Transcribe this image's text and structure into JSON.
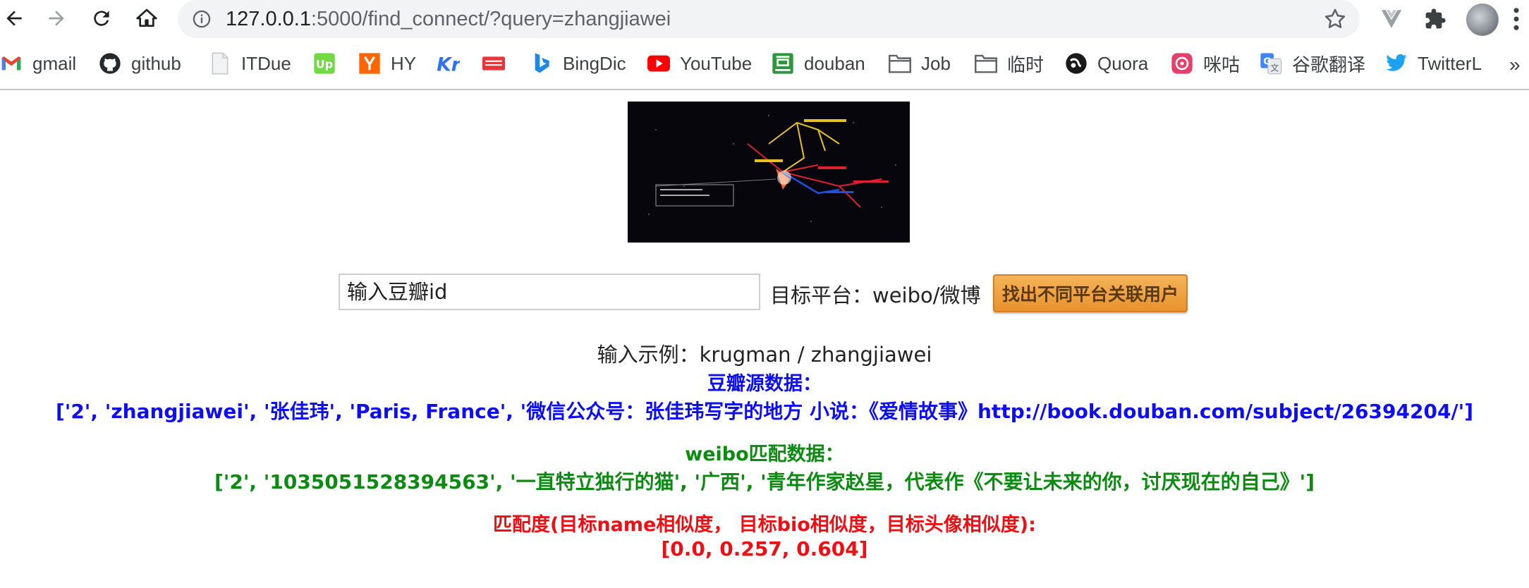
{
  "browser": {
    "url_host": "127.0.0.1",
    "url_path": ":5000/find_connect/?query=zhangjiawei"
  },
  "bookmarks": [
    {
      "label": "gmail",
      "icon": "gmail-icon"
    },
    {
      "label": "github",
      "icon": "github-icon"
    },
    {
      "label": "ITDue",
      "icon": "page-icon"
    },
    {
      "label": "",
      "icon": "upwork-icon"
    },
    {
      "label": "HY",
      "icon": "hacker-news-icon"
    },
    {
      "label": "",
      "icon": "kr-icon"
    },
    {
      "label": "",
      "icon": "toutiao-icon"
    },
    {
      "label": "BingDic",
      "icon": "bing-icon"
    },
    {
      "label": "YouTube",
      "icon": "youtube-icon"
    },
    {
      "label": "douban",
      "icon": "douban-icon"
    },
    {
      "label": "Job",
      "icon": "folder-icon"
    },
    {
      "label": "临时",
      "icon": "folder-icon"
    },
    {
      "label": "Quora",
      "icon": "quora-icon"
    },
    {
      "label": "咪咕",
      "icon": "migu-icon"
    },
    {
      "label": "谷歌翻译",
      "icon": "google-translate-icon"
    },
    {
      "label": "TwitterL",
      "icon": "twitter-icon"
    }
  ],
  "form": {
    "input_placeholder": "输入豆瓣id",
    "target_label": "目标平台：weibo/微博",
    "button_label": "找出不同平台关联用户"
  },
  "example_text": "输入示例：krugman / zhangjiawei",
  "results": {
    "source_title": "豆瓣源数据：",
    "source_data": "['2', 'zhangjiawei', '张佳玮', 'Paris, France', '微信公众号：张佳玮写字的地方 小说：《爱情故事》http://book.douban.com/subject/26394204/']",
    "match_title": "weibo匹配数据：",
    "match_data": "['2', '1035051528394563', '一直特立独行的猫', '广西', '青年作家赵星，代表作《不要让未来的你，讨厌现在的自己》']",
    "score_title": "匹配度(目标name相似度， 目标bio相似度，目标头像相似度):",
    "score_data": "[0.0, 0.257, 0.604]"
  },
  "colors": {
    "source": "#0d0ff0",
    "match": "#0c8a12",
    "score": "#ee0f14",
    "button": "#f0a040"
  }
}
